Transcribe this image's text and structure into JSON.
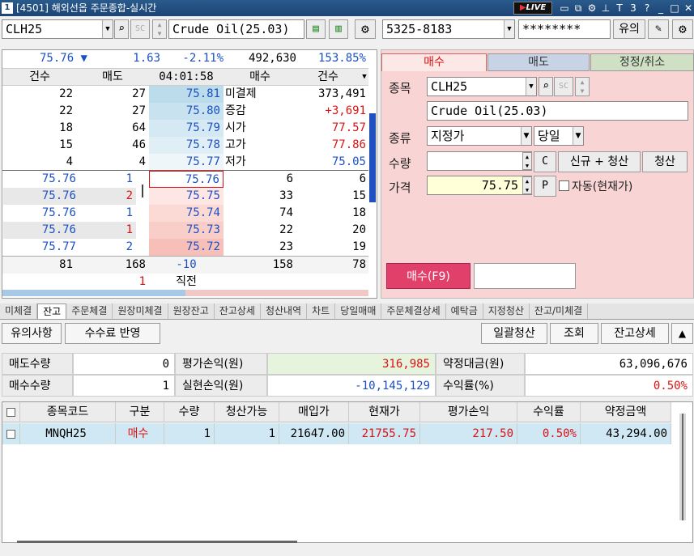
{
  "window": {
    "number": "1",
    "title": "[4501] 해외선옵 주문종합-실시간",
    "live_prefix": "▶",
    "live_label": "LIVE"
  },
  "toolbar_left": {
    "symbol": "CLH25",
    "name": "Crude Oil(25.03)"
  },
  "toolbar_right": {
    "account": "5325-8183",
    "password": "********",
    "notice_label": "유의"
  },
  "quote_summary": {
    "price": "75.76 ▼",
    "change": "1.63",
    "pct": "-2.11%",
    "volume": "492,630",
    "ratio": "153.85%"
  },
  "book_header": {
    "h1": "건수",
    "h2": "매도",
    "time": "04:01:58",
    "h3": "매수",
    "h4": "건수"
  },
  "ask_rows": [
    {
      "cnt": "22",
      "qty": "27",
      "price": "75.81",
      "label": "미결제",
      "value": "373,491"
    },
    {
      "cnt": "22",
      "qty": "27",
      "price": "75.80",
      "label": "증감",
      "value": "+3,691"
    },
    {
      "cnt": "18",
      "qty": "64",
      "price": "75.79",
      "label": "시가",
      "value": "77.57"
    },
    {
      "cnt": "15",
      "qty": "46",
      "price": "75.78",
      "label": "고가",
      "value": "77.86"
    },
    {
      "cnt": "4",
      "qty": "4",
      "price": "75.77",
      "label": "저가",
      "value": "75.05"
    }
  ],
  "bid_rows": [
    {
      "tick": "75.76",
      "tqty": "1",
      "price": "75.76",
      "qty": "6",
      "cnt": "6"
    },
    {
      "tick": "75.76",
      "tqty": "2",
      "price": "75.75",
      "qty": "33",
      "cnt": "15"
    },
    {
      "tick": "75.76",
      "tqty": "1",
      "price": "75.74",
      "qty": "74",
      "cnt": "18"
    },
    {
      "tick": "75.76",
      "tqty": "1",
      "price": "75.73",
      "qty": "22",
      "cnt": "20"
    },
    {
      "tick": "75.77",
      "tqty": "2",
      "price": "75.72",
      "qty": "23",
      "cnt": "19"
    }
  ],
  "book_totals": {
    "ask_cnt": "81",
    "ask_qty": "168",
    "diff": "-10",
    "bid_qty": "158",
    "bid_cnt": "78",
    "last_qty": "1",
    "last_label": "직전"
  },
  "order": {
    "tabs": [
      "매수",
      "매도",
      "정정/취소"
    ],
    "symbol_label": "종목",
    "symbol": "CLH25",
    "name": "Crude Oil(25.03)",
    "type_label": "종류",
    "type": "지정가",
    "cond": "당일",
    "qty_label": "수량",
    "qty": "",
    "c_label": "C",
    "new_close_label": "신규 + 청산",
    "close_label": "청산",
    "price_label": "가격",
    "price": "75.75",
    "p_label": "P",
    "auto_label": "자동(현재가)",
    "submit_label": "매수(F9)"
  },
  "bottom_tabs": [
    "미체결",
    "잔고",
    "주문체결",
    "원장미체결",
    "원장잔고",
    "잔고상세",
    "청산내역",
    "차트",
    "당일매매",
    "주문체결상세",
    "예탁금",
    "지정청산",
    "잔고/미체결"
  ],
  "actions": {
    "notice": "유의사항",
    "fee": "수수료 반영",
    "close_all": "일괄청산",
    "query": "조회",
    "detail": "잔고상세"
  },
  "summary": {
    "sell_qty_label": "매도수량",
    "sell_qty": "0",
    "eval_label": "평가손익(원)",
    "eval": "316,985",
    "contract_label": "약정대금(원)",
    "contract": "63,096,676",
    "buy_qty_label": "매수수량",
    "buy_qty": "1",
    "realized_label": "실현손익(원)",
    "realized": "-10,145,129",
    "rate_label": "수익률(%)",
    "rate": "0.50%"
  },
  "table": {
    "headers": [
      "종목코드",
      "구분",
      "수량",
      "청산가능",
      "매입가",
      "현재가",
      "평가손익",
      "수익률",
      "약정금액"
    ],
    "rows": [
      {
        "code": "MNQH25",
        "side": "매수",
        "qty": "1",
        "closable": "1",
        "buy": "21647.00",
        "cur": "21755.75",
        "pl": "217.50",
        "rate": "0.50%",
        "amount": "43,294.00"
      }
    ]
  },
  "colors": {
    "accent_blue": "#1b4fc4",
    "accent_red": "#d11",
    "buy_panel": "#f8d4d4",
    "buy_button": "#e0406a"
  }
}
